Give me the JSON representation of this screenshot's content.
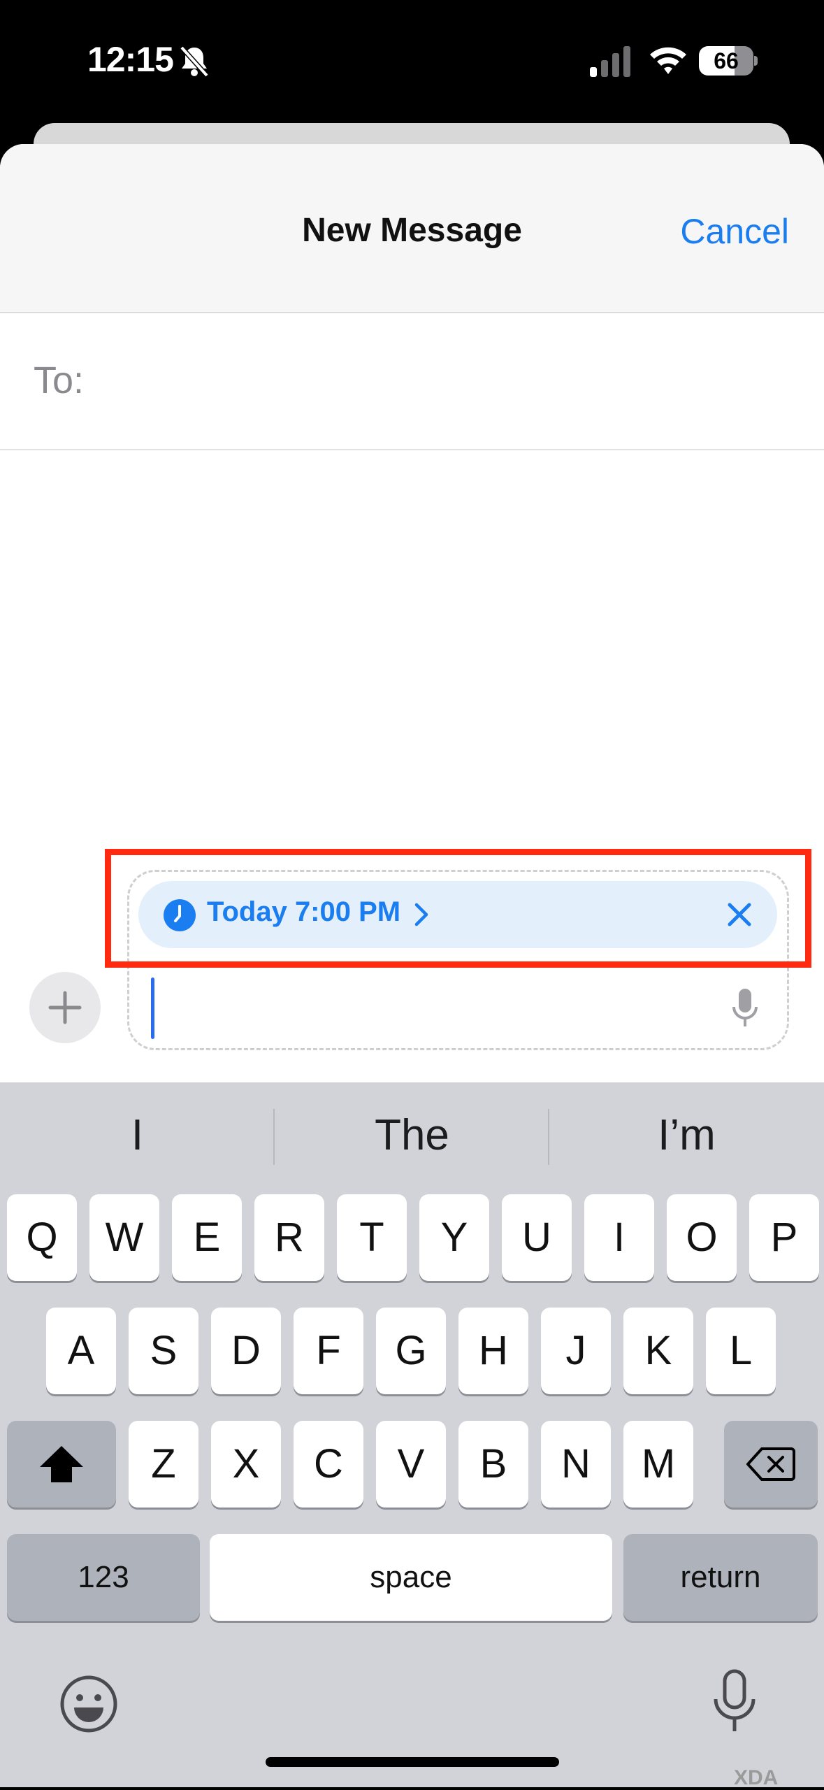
{
  "status_bar": {
    "time": "12:15",
    "battery": "66",
    "battery_fraction": 0.66
  },
  "nav": {
    "title": "New Message",
    "cancel_label": "Cancel"
  },
  "recipients": {
    "to_label": "To:"
  },
  "scheduled_send": {
    "label": "Today 7:00 PM"
  },
  "keyboard": {
    "suggestions": [
      "I",
      "The",
      "I’m"
    ],
    "row1": [
      "Q",
      "W",
      "E",
      "R",
      "T",
      "Y",
      "U",
      "I",
      "O",
      "P"
    ],
    "row2": [
      "A",
      "S",
      "D",
      "F",
      "G",
      "H",
      "J",
      "K",
      "L"
    ],
    "row3": [
      "Z",
      "X",
      "C",
      "V",
      "B",
      "N",
      "M"
    ],
    "numbers_label": "123",
    "space_label": "space",
    "return_label": "return"
  },
  "colors": {
    "accent": "#1a7df0",
    "highlight": "#ff2a10"
  },
  "watermark": "XDA"
}
